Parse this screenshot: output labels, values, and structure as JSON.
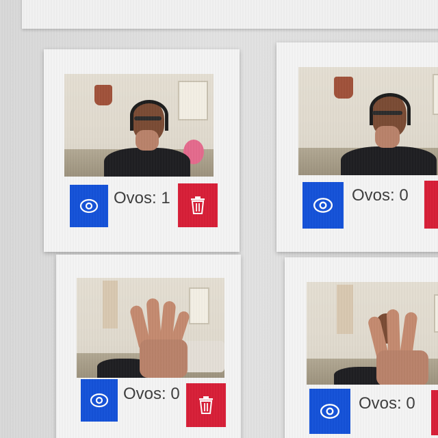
{
  "cards": [
    {
      "count_label": "Ovos: 1",
      "view_icon": "eye-icon",
      "delete_icon": "trash-icon"
    },
    {
      "count_label": "Ovos: 0",
      "view_icon": "eye-icon",
      "delete_icon": "trash-icon"
    },
    {
      "count_label": "Ovos: 0",
      "view_icon": "eye-icon",
      "delete_icon": "trash-icon"
    },
    {
      "count_label": "Ovos: 0",
      "view_icon": "eye-icon",
      "delete_icon": "trash-icon"
    }
  ],
  "colors": {
    "view_button": "#1452d8",
    "delete_button": "#d71f37",
    "card_background": "#f4f4f4",
    "page_background": "#dcdcdc"
  }
}
